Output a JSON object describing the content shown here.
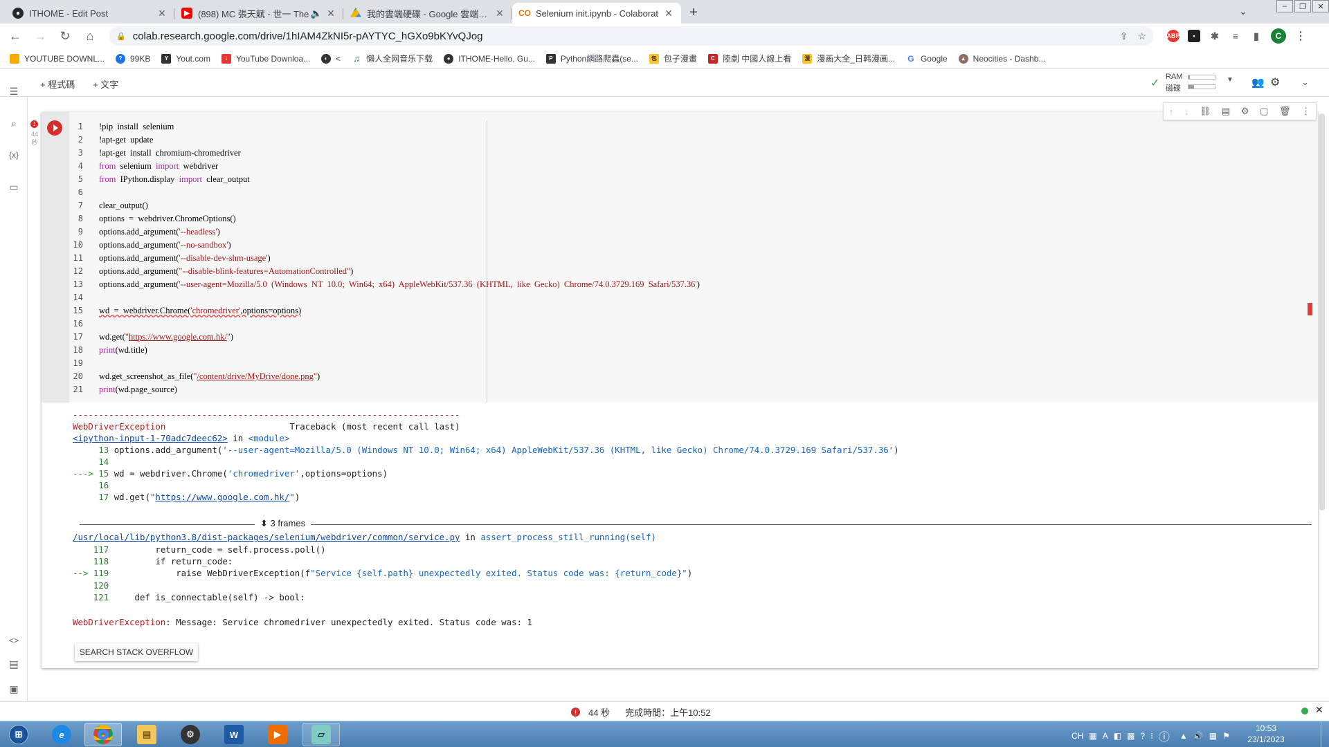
{
  "browser": {
    "tabs": [
      {
        "title": "ITHOME - Edit Post",
        "icon": "github-icon",
        "color": "#24292e",
        "active": false
      },
      {
        "title": "(898) MC 張天賦 - 世一 The",
        "icon": "youtube-icon",
        "color": "#ff0000",
        "active": false
      },
      {
        "title": "我的雲端硬碟 - Google 雲端硬碟",
        "icon": "google-drive-icon",
        "color": "#1a73e8",
        "active": false
      },
      {
        "title": "Selenium init.ipynb - Colaborat",
        "icon": "colab-icon",
        "color": "#f9ab00",
        "active": true
      }
    ],
    "new_tab": "+",
    "url": "colab.research.google.com/drive/1hIAM4ZkNI5r-pAYTYC_hGXo9bKYvQJog",
    "profile_initial": "C"
  },
  "bookmarks": [
    {
      "label": "YOUTUBE DOWNL...",
      "color": "#f9ab00"
    },
    {
      "label": "99KB",
      "color": "#1a73e8"
    },
    {
      "label": "Yout.com",
      "color": "#333333"
    },
    {
      "label": "YouTube Downloa...",
      "color": "#e53935"
    },
    {
      "label": "<",
      "color": "#333333"
    },
    {
      "label": "懶人全网音乐下载",
      "color": "#2e7d32"
    },
    {
      "label": "ITHOME-Hello, Gu...",
      "color": "#333333"
    },
    {
      "label": "Python網路爬蟲(se...",
      "color": "#333333"
    },
    {
      "label": "包子漫畫",
      "color": "#fbc02d"
    },
    {
      "label": "陸劇 中國人線上看",
      "color": "#c62828"
    },
    {
      "label": "漫画大全_日韩漫画...",
      "color": "#fbc02d"
    },
    {
      "label": "Google",
      "color": "#4285f4"
    },
    {
      "label": "Neocities - Dashb...",
      "color": "#8d6e63"
    }
  ],
  "colab": {
    "add_code": "+ 程式碼",
    "add_text": "+ 文字",
    "ram_label": "RAM",
    "disk_label": "磁碟",
    "ram_fill": 0.05,
    "disk_fill": 0.2,
    "exec_time_side": "44\n秒"
  },
  "code": {
    "line_numbers": [
      "1",
      "2",
      "3",
      "4",
      "5",
      "6",
      "7",
      "8",
      "9",
      "10",
      "11",
      "12",
      "13",
      "14",
      "15",
      "16",
      "17",
      "18",
      "19",
      "20",
      "21"
    ]
  },
  "output": {
    "dashes": "---------------------------------------------------------------------------",
    "exception_name": "WebDriverException",
    "traceback_head": "Traceback (most recent call last)",
    "input_link": "<ipython-input-1-70adc7deec62>",
    "in_word": " in ",
    "module": "<module>",
    "frames_label": "3 frames",
    "service_path": "/usr/local/lib/python3.8/dist-packages/selenium/webdriver/common/service.py",
    "func": "assert_process_still_running(self)",
    "final_name": "WebDriverException",
    "final_msg": ": Message: Service chromedriver unexpectedly exited. Status code was: 1",
    "search_so": "SEARCH STACK OVERFLOW"
  },
  "status": {
    "time": "44 秒",
    "completed": "完成時間：上午10:52"
  },
  "taskbar": {
    "lang": "CH",
    "clock_time": "10:53",
    "clock_date": "23/1/2023"
  }
}
